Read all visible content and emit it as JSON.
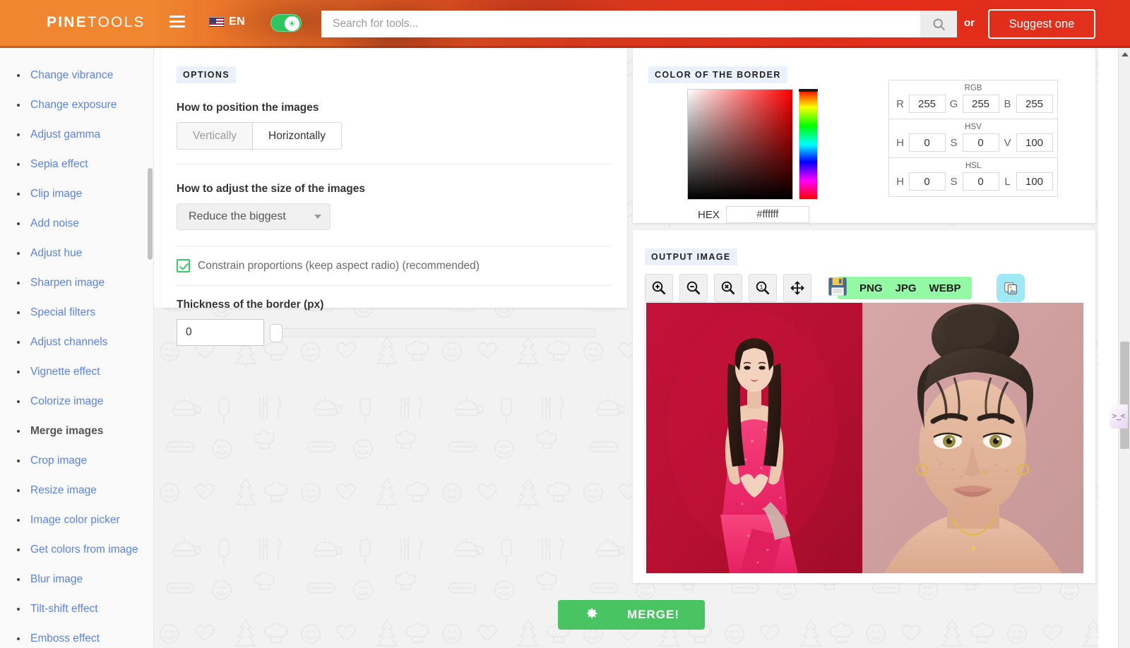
{
  "header": {
    "logo_bold": "PINE",
    "logo_light": "TOOLS",
    "menu_icon": "hamburger-icon",
    "language_code": "EN",
    "flag_icon": "us-flag-icon",
    "theme_icon": "sun-icon",
    "search": {
      "value": "",
      "placeholder": "Search for tools...",
      "icon": "search-icon"
    },
    "or_label": "or",
    "suggest_label": "Suggest one"
  },
  "sidebar": {
    "items": [
      {
        "label": "Change vibrance",
        "active": false
      },
      {
        "label": "Change exposure",
        "active": false
      },
      {
        "label": "Adjust gamma",
        "active": false
      },
      {
        "label": "Sepia effect",
        "active": false
      },
      {
        "label": "Clip image",
        "active": false
      },
      {
        "label": "Add noise",
        "active": false
      },
      {
        "label": "Adjust hue",
        "active": false
      },
      {
        "label": "Sharpen image",
        "active": false
      },
      {
        "label": "Special filters",
        "active": false
      },
      {
        "label": "Adjust channels",
        "active": false
      },
      {
        "label": "Vignette effect",
        "active": false
      },
      {
        "label": "Colorize image",
        "active": false
      },
      {
        "label": "Merge images",
        "active": true
      },
      {
        "label": "Crop image",
        "active": false
      },
      {
        "label": "Resize image",
        "active": false
      },
      {
        "label": "Image color picker",
        "active": false
      },
      {
        "label": "Get colors from image",
        "active": false
      },
      {
        "label": "Blur image",
        "active": false
      },
      {
        "label": "Tilt-shift effect",
        "active": false
      },
      {
        "label": "Emboss effect",
        "active": false
      }
    ]
  },
  "options": {
    "title": "OPTIONS",
    "position_label": "How to position the images",
    "position_vertical": "Vertically",
    "position_horizontal": "Horizontally",
    "position_selected": "Horizontally",
    "size_label": "How to adjust the size of the images",
    "size_selected": "Reduce the biggest",
    "constrain_label": "Constrain proportions (keep aspect radio) (recommended)",
    "constrain_checked": true,
    "border_label": "Thickness of the border (px)",
    "border_value": "0",
    "border_slider_percent": 0
  },
  "color": {
    "title": "COLOR OF THE BORDER",
    "hex_label": "HEX",
    "hex_value": "#ffffff",
    "groups": [
      {
        "name": "RGB",
        "fields": [
          {
            "key": "R",
            "value": "255"
          },
          {
            "key": "G",
            "value": "255"
          },
          {
            "key": "B",
            "value": "255"
          }
        ]
      },
      {
        "name": "HSV",
        "fields": [
          {
            "key": "H",
            "value": "0"
          },
          {
            "key": "S",
            "value": "0"
          },
          {
            "key": "V",
            "value": "100"
          }
        ]
      },
      {
        "name": "HSL",
        "fields": [
          {
            "key": "H",
            "value": "0"
          },
          {
            "key": "S",
            "value": "0"
          },
          {
            "key": "L",
            "value": "100"
          }
        ]
      }
    ]
  },
  "output": {
    "title": "OUTPUT IMAGE",
    "tools": [
      {
        "name": "zoom-in-icon"
      },
      {
        "name": "zoom-out-icon"
      },
      {
        "name": "zoom-reset-icon"
      },
      {
        "name": "zoom-actual-size-icon"
      },
      {
        "name": "move-icon"
      }
    ],
    "save_icon": "floppy-disk-icon",
    "formats": [
      "PNG",
      "JPG",
      "WEBP"
    ],
    "copy_icon": "copy-images-icon",
    "image_alt_left": "woman in pink sequin dress on red background",
    "image_alt_right": "close-up portrait of woman on pink background"
  },
  "action": {
    "merge_label": "MERGE!",
    "gear_icon": "gear-icon"
  },
  "widget": {
    "face": ">_<"
  },
  "colors": {
    "accent_orange": "#f08630",
    "accent_red": "#e0331c",
    "link_blue": "#5b82e6",
    "green": "#4ac362",
    "save_green": "#93f9a4",
    "copy_cyan": "#9fe8f5"
  }
}
